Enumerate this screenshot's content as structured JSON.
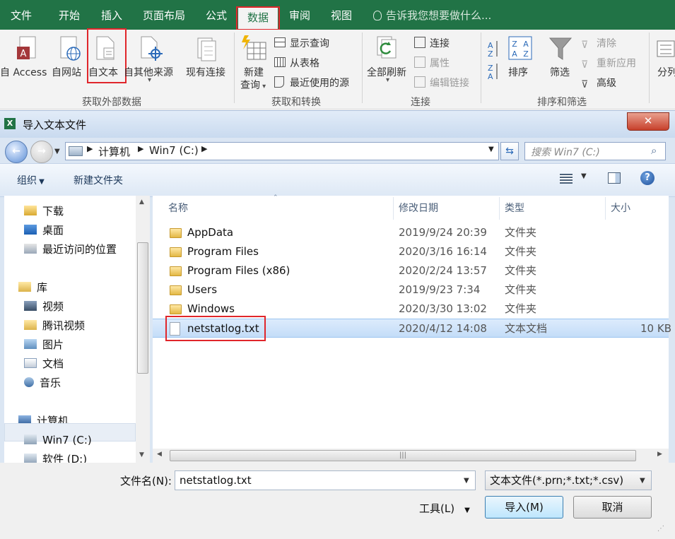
{
  "ribbon": {
    "tabs": [
      "文件",
      "开始",
      "插入",
      "页面布局",
      "公式",
      "数据",
      "审阅",
      "视图"
    ],
    "active_tab": "数据",
    "tell_me": "告诉我您想要做什么...",
    "groups": {
      "external": {
        "label": "获取外部数据",
        "buttons": [
          "自 Access",
          "自网站",
          "自文本",
          "自其他来源",
          "现有连接"
        ]
      },
      "transform": {
        "label": "获取和转换",
        "new_query_line1": "新建",
        "new_query_line2": "查询",
        "show_queries": "显示查询",
        "from_table": "从表格",
        "recent_sources": "最近使用的源"
      },
      "connections": {
        "label": "连接",
        "refresh_all": "全部刷新",
        "connections": "连接",
        "properties": "属性",
        "edit_links": "编辑链接"
      },
      "sort_filter": {
        "label": "排序和筛选",
        "sort": "排序",
        "filter": "筛选",
        "clear": "清除",
        "reapply": "重新应用",
        "advanced": "高级"
      },
      "more": {
        "split": "分列"
      }
    }
  },
  "dialog": {
    "title": "导入文本文件",
    "close_glyph": "✕",
    "breadcrumb": [
      "计算机",
      "Win7 (C:)"
    ],
    "search_placeholder": "搜索 Win7 (C:)",
    "toolbar": {
      "organize": "组织",
      "new_folder": "新建文件夹"
    },
    "nav": {
      "items": [
        {
          "label": "下载"
        },
        {
          "label": "桌面"
        },
        {
          "label": "最近访问的位置"
        },
        {
          "label": "库"
        },
        {
          "label": "视频"
        },
        {
          "label": "腾讯视频"
        },
        {
          "label": "图片"
        },
        {
          "label": "文档"
        },
        {
          "label": "音乐"
        },
        {
          "label": "计算机"
        },
        {
          "label": "Win7 (C:)"
        },
        {
          "label": "软件 (D:)"
        }
      ]
    },
    "columns": [
      "名称",
      "修改日期",
      "类型",
      "大小"
    ],
    "files": [
      {
        "name": "AppData",
        "date": "2019/9/24 20:39",
        "type": "文件夹",
        "size": ""
      },
      {
        "name": "Program Files",
        "date": "2020/3/16 16:14",
        "type": "文件夹",
        "size": ""
      },
      {
        "name": "Program Files (x86)",
        "date": "2020/2/24 13:57",
        "type": "文件夹",
        "size": ""
      },
      {
        "name": "Users",
        "date": "2019/9/23 7:34",
        "type": "文件夹",
        "size": ""
      },
      {
        "name": "Windows",
        "date": "2020/3/30 13:02",
        "type": "文件夹",
        "size": ""
      },
      {
        "name": "netstatlog.txt",
        "date": "2020/4/12 14:08",
        "type": "文本文档",
        "size": "10 KB"
      }
    ],
    "filename_label": "文件名(N):",
    "filename_value": "netstatlog.txt",
    "filetype_value": "文本文件(*.prn;*.txt;*.csv)",
    "tools_label": "工具(L)",
    "import_button": "导入(M)",
    "cancel_button": "取消"
  },
  "colors": {
    "excel_green": "#217346",
    "highlight_red": "#e0262b",
    "selection_blue": "#c4ddf8"
  }
}
